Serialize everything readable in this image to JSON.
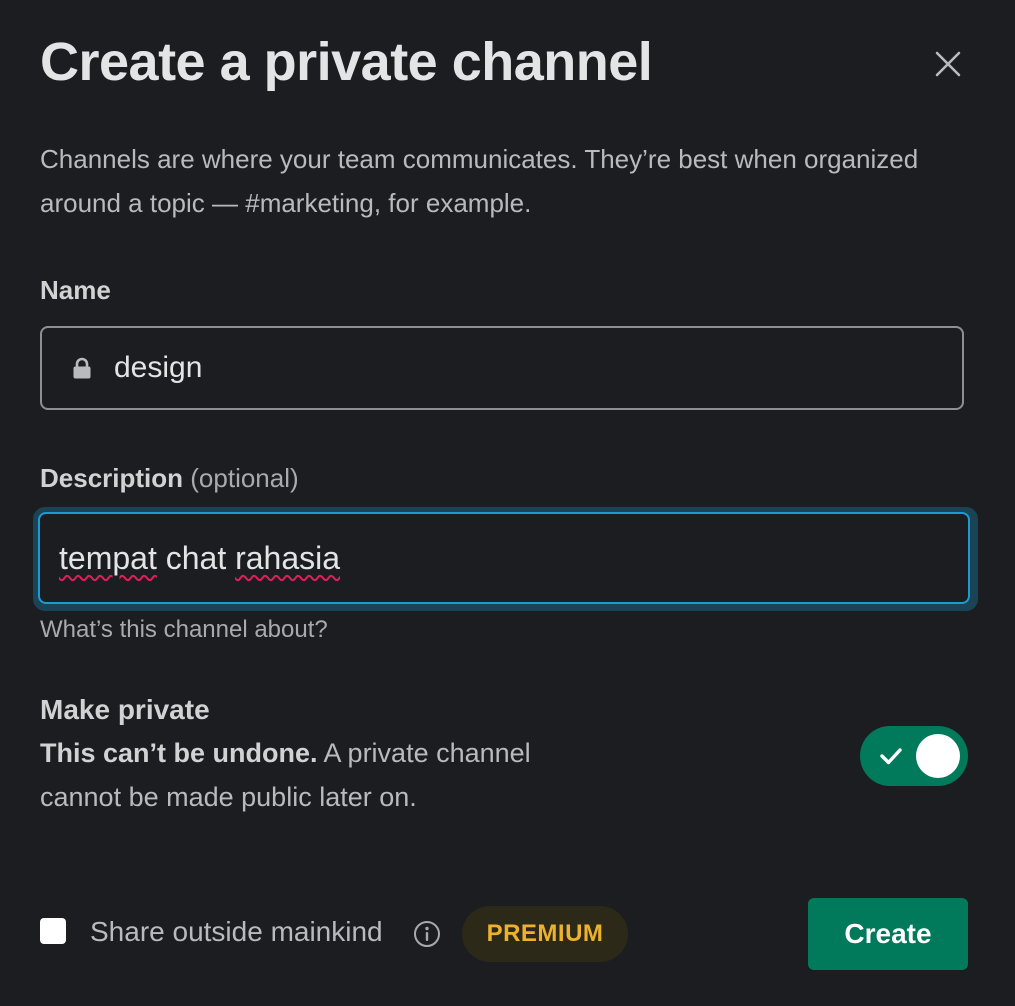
{
  "dialog": {
    "title": "Create a private channel",
    "intro": "Channels are where your team communicates. They’re best when organized around a topic — #marketing, for example."
  },
  "name_field": {
    "label": "Name",
    "value": "design",
    "icon": "lock-icon"
  },
  "description_field": {
    "label": "Description",
    "optional_label": "(optional)",
    "value_word1": "tempat",
    "value_word2": "chat",
    "value_word3": "rahasia",
    "hint": "What’s this channel about?"
  },
  "privacy": {
    "title": "Make private",
    "warning_bold": "This can’t be undone.",
    "warning_text": "A private channel cannot be made public later on.",
    "enabled": true
  },
  "footer": {
    "share_label": "Share outside mainkind",
    "share_checked": false,
    "premium_badge": "PREMIUM",
    "create_label": "Create"
  },
  "colors": {
    "background": "#1b1d21",
    "accent_green": "#007a5a",
    "focus_blue": "#1d9bd1",
    "premium_gold": "#ecb22e"
  }
}
